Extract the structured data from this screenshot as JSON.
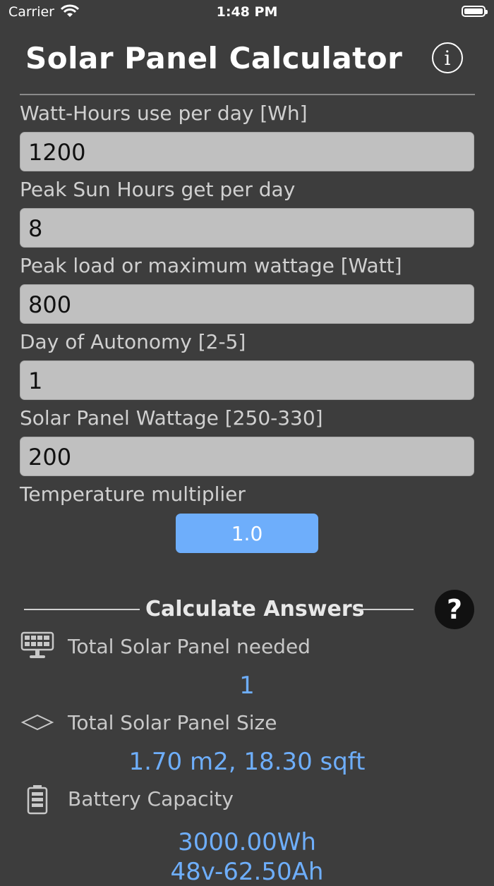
{
  "status_bar": {
    "carrier": "Carrier",
    "time": "1:48 PM"
  },
  "header": {
    "title": "Solar Panel Calculator",
    "info_icon": "info-icon"
  },
  "inputs": [
    {
      "label": "Watt-Hours use per day [Wh]",
      "value": "1200"
    },
    {
      "label": "Peak Sun Hours get per day",
      "value": "8"
    },
    {
      "label": "Peak load or maximum wattage [Watt]",
      "value": "800"
    },
    {
      "label": "Day of Autonomy [2-5]",
      "value": "1"
    },
    {
      "label": "Solar Panel Wattage [250-330]",
      "value": "200"
    }
  ],
  "temperature": {
    "label": "Temperature multiplier",
    "value": "1.0"
  },
  "calculate": {
    "label": "Calculate Answers",
    "help_icon": "question-icon"
  },
  "results": [
    {
      "icon": "solar-panel-icon",
      "label": "Total Solar Panel needed",
      "value": "1"
    },
    {
      "icon": "size-diamond-icon",
      "label": "Total Solar Panel Size",
      "value": "1.70 m2, 18.30 sqft"
    },
    {
      "icon": "battery-icon",
      "label": "Battery Capacity",
      "value": "3000.00Wh",
      "value2": "48v-62.50Ah"
    }
  ],
  "colors": {
    "background": "#3d3d3d",
    "accent": "#6eaefb",
    "field_bg": "#c0c0c0"
  }
}
